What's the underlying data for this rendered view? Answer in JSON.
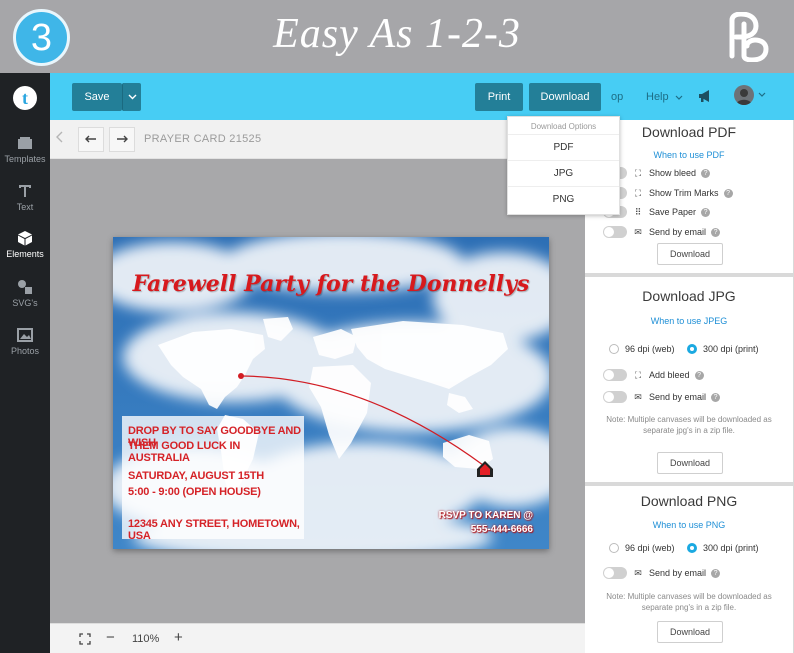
{
  "banner": {
    "step": "3",
    "title": "Easy As 1-2-3",
    "brand_logo_icon": "pb-monogram-logo"
  },
  "sidebar": {
    "logo_icon": "app-logo-icon",
    "logo_letter": "t",
    "items": [
      {
        "label": "Templates",
        "icon": "templates-icon",
        "active": false
      },
      {
        "label": "Text",
        "icon": "text-icon",
        "active": false
      },
      {
        "label": "Elements",
        "icon": "cube-icon",
        "active": true
      },
      {
        "label": "SVG's",
        "icon": "shapes-icon",
        "active": false
      },
      {
        "label": "Photos",
        "icon": "image-icon",
        "active": false
      }
    ]
  },
  "toolbar": {
    "save_label": "Save",
    "print_label": "Print",
    "download_label": "Download",
    "truncated_label": "op",
    "help_label": "Help",
    "accent": "#47cdf4",
    "button_color": "#237f98"
  },
  "subbar": {
    "doc_title": "PRAYER CARD 21525"
  },
  "card": {
    "title": "Farewell Party for the Donnellys",
    "lines": [
      "DROP BY TO SAY GOODBYE AND WISH",
      "THEM GOOD LUCK IN AUSTRALIA",
      "SATURDAY, AUGUST 15TH",
      "5:00 - 9:00 (OPEN HOUSE)",
      "12345 ANY STREET, HOMETOWN, USA"
    ],
    "rsvp_line1": "RSVP TO KAREN @",
    "rsvp_line2": "555-444-6666",
    "title_color": "#d7191d"
  },
  "zoom": {
    "level": "110%",
    "minus": "−",
    "plus": "+"
  },
  "dropdown": {
    "header": "Download Options",
    "items": [
      "PDF",
      "JPG",
      "PNG"
    ]
  },
  "panels": {
    "pdf": {
      "title": "Download PDF",
      "link": "When to use PDF",
      "options": [
        "Show bleed",
        "Show Trim Marks",
        "Save Paper",
        "Send by email"
      ],
      "button": "Download"
    },
    "jpg": {
      "title": "Download JPG",
      "link": "When to use JPEG",
      "dpi_web": "96 dpi (web)",
      "dpi_print": "300 dpi (print)",
      "options": [
        "Add bleed",
        "Send by email"
      ],
      "note": "Note: Multiple canvases will be downloaded as separate jpg's in a zip file.",
      "button": "Download"
    },
    "png": {
      "title": "Download PNG",
      "link": "When to use PNG",
      "dpi_web": "96 dpi (web)",
      "dpi_print": "300 dpi (print)",
      "options": [
        "Send by email"
      ],
      "note": "Note: Multiple canvases will be downloaded as separate png's in a zip file.",
      "button": "Download"
    }
  }
}
